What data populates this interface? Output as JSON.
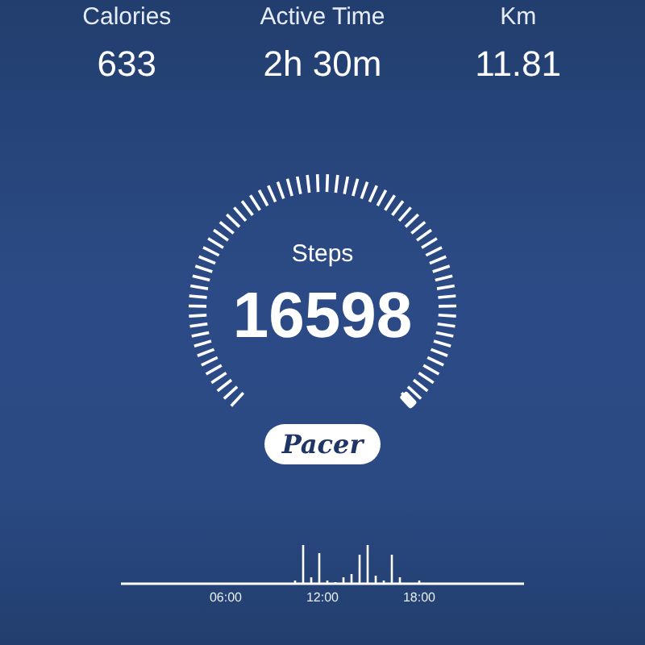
{
  "stats": [
    {
      "label": "Calories",
      "value": "633"
    },
    {
      "label": "Active Time",
      "value": "2h 30m"
    },
    {
      "label": "Km",
      "value": "11.81"
    }
  ],
  "steps": {
    "label": "Steps",
    "value": "16598"
  },
  "logo": "Pacer",
  "timeline": {
    "labels": [
      "06:00",
      "12:00",
      "18:00"
    ]
  }
}
